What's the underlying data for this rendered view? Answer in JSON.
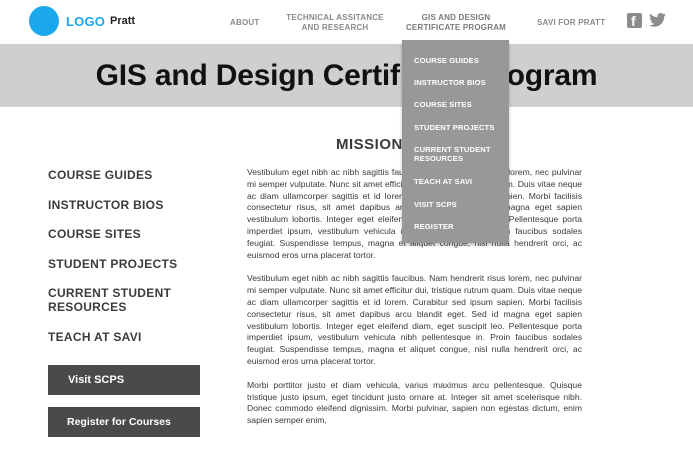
{
  "header": {
    "logo_text": "LOGO",
    "logo_sub": "Pratt",
    "nav": {
      "about": "ABOUT",
      "tech_line1": "TECHNICAL ASSITANCE",
      "tech_line2": "AND RESEARCH",
      "gis_line1": "GIS AND DESIGN",
      "gis_line2": "CERTIFICATE PROGRAM",
      "savi": "SAVI FOR PRATT"
    },
    "social": {
      "facebook_icon": "facebook-icon",
      "twitter_icon": "twitter-icon"
    },
    "brand_color": "#1aa7ec"
  },
  "banner": {
    "title": "GIS and Design Certificate Program"
  },
  "dropdown": {
    "items": [
      {
        "line1": "COURSE GUIDES",
        "line2": ""
      },
      {
        "line1": "INSTRUCTOR BIOS",
        "line2": ""
      },
      {
        "line1": "COURSE SITES",
        "line2": ""
      },
      {
        "line1": "STUDENT PROJECTS",
        "line2": ""
      },
      {
        "line1": "CURRENT STUDENT",
        "line2": "RESOURCES"
      },
      {
        "line1": "TEACH AT SAVI",
        "line2": ""
      },
      {
        "line1": "VISIT SCPS",
        "line2": ""
      },
      {
        "line1": "REGISTER",
        "line2": ""
      }
    ]
  },
  "main": {
    "heading": "MISSION"
  },
  "sidebar": {
    "items": [
      {
        "line1": "COURSE GUIDES",
        "line2": ""
      },
      {
        "line1": "INSTRUCTOR BIOS",
        "line2": ""
      },
      {
        "line1": "COURSE SITES",
        "line2": ""
      },
      {
        "line1": "STUDENT PROJECTS",
        "line2": ""
      },
      {
        "line1": "CURRENT STUDENT",
        "line2": "RESOURCES"
      },
      {
        "line1": "TEACH AT SAVI",
        "line2": ""
      }
    ],
    "buttons": {
      "visit": "Visit SCPS",
      "register": "Register for Courses"
    }
  },
  "content": {
    "paragraphs": [
      "Vestibulum eget nibh ac nibh sagittis faucibus. Nam hendrerit risus lorem, nec pulvinar mi semper vulputate. Nunc sit amet efficitur dui, tristique rutrum quam. Duis vitae neque ac diam ullamcorper sagittis et id lorem. Curabitur sed ipsum sapien. Morbi facilisis consectetur risus, sit amet dapibus arcu blandit eget. Sed id magna eget sapien vestibulum lobortis. Integer eget eleifend diam, eget suscipit leo. Pellentesque porta imperdiet ipsum, vestibulum vehicula nibh pellentesque in. Proin faucibus sodales feugiat. Suspendisse tempus, magna et aliquet congue, nisl nulla hendrerit orci, ac euismod eros urna placerat tortor.",
      "Vestibulum eget nibh ac nibh sagittis faucibus. Nam hendrerit risus lorem, nec pulvinar mi semper vulputate. Nunc sit amet efficitur dui, tristique rutrum quam. Duis vitae neque ac diam ullamcorper sagittis et id lorem. Curabitur sed ipsum sapien. Morbi facilisis consectetur risus, sit amet dapibus arcu blandit eget. Sed id magna eget sapien vestibulum lobortis. Integer eget eleifend diam, eget suscipit leo. Pellentesque porta imperdiet ipsum, vestibulum vehicula nibh pellentesque in. Proin faucibus sodales feugiat. Suspendisse tempus, magna et aliquet congue, nisl nulla hendrerit orci, ac euismod eros urna placerat tortor.",
      "Morbi porttitor justo et diam vehicula, varius maximus arcu pellentesque. Quisque tristique justo ipsum, eget tincidunt justo ornare at. Integer sit amet scelerisque nibh. Donec commodo eleifend dignissim. Morbi pulvinar, sapien non egestas dictum, enim sapien semper enim,"
    ]
  }
}
